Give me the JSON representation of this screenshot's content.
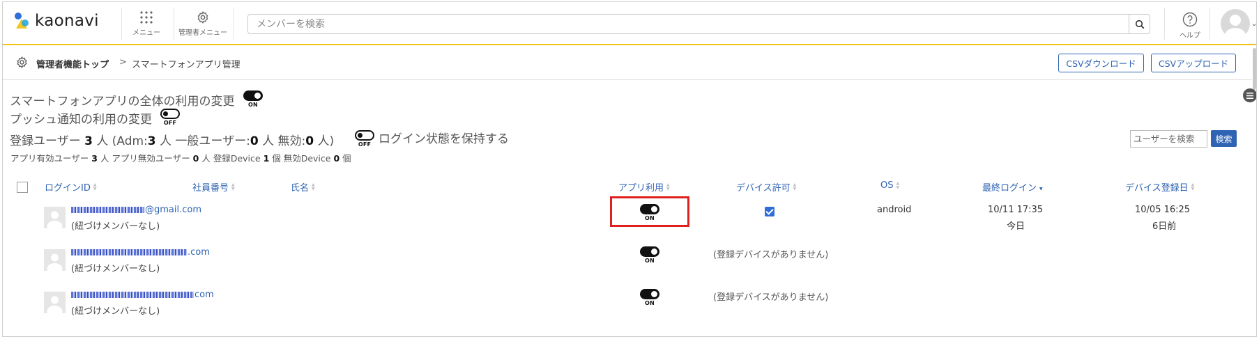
{
  "header": {
    "logo_text": "kaonavi",
    "menu_label": "メニュー",
    "admin_menu_label": "管理者メニュー",
    "search_placeholder": "メンバーを検索",
    "help_label": "ヘルプ"
  },
  "breadcrumb": {
    "root": "管理者機能トップ",
    "separator": ">",
    "current": "スマートフォンアプリ管理"
  },
  "actions": {
    "csv_download": "CSVダウンロード",
    "csv_upload": "CSVアップロード"
  },
  "settings": {
    "app_usage_label": "スマートフォンアプリの全体の利用の変更",
    "app_usage_state": "ON",
    "push_label": "プッシュ通知の利用の変更",
    "push_state": "OFF",
    "keep_login_state": "OFF",
    "keep_login_label": "ログイン状態を保持する"
  },
  "stats": {
    "reg_prefix": "登録ユーザー",
    "reg_count": "3",
    "reg_mid1": "人 (Adm:",
    "adm_count": "3",
    "reg_mid2": "人 一般ユーザー:",
    "general_count": "0",
    "reg_mid3": "人 無効:",
    "invalid_count": "0",
    "reg_suffix": "人)",
    "app_valid_label": "アプリ有効ユーザー",
    "app_valid_count": "3",
    "app_invalid_label": "人 アプリ無効ユーザー",
    "app_invalid_count": "0",
    "device_label": "人 登録Device",
    "device_count": "1",
    "invalid_device_label": "個 無効Device",
    "invalid_device_count": "0",
    "unit": "個"
  },
  "user_search": {
    "placeholder": "ユーザーを検索",
    "button": "検索"
  },
  "table": {
    "columns": [
      "ログインID",
      "社員番号",
      "氏名",
      "アプリ利用",
      "デバイス許可",
      "OS",
      "最終ログイン",
      "デバイス登録日"
    ],
    "rows": [
      {
        "email_suffix": "@gmail.com",
        "member": "(紐づけメンバーなし)",
        "app_state": "ON",
        "os": "android",
        "last_login": "10/11 17:35",
        "last_login_rel": "今日",
        "reg_date": "10/05 16:25",
        "reg_date_rel": "6日前"
      },
      {
        "email_suffix": ".com",
        "member": "(紐づけメンバーなし)",
        "app_state": "ON",
        "no_device": "(登録デバイスがありません)"
      },
      {
        "email_suffix": "com",
        "member": "(紐づけメンバーなし)",
        "app_state": "ON",
        "no_device": "(登録デバイスがありません)"
      }
    ]
  },
  "colors": {
    "accent_yellow": "#f2c418",
    "link_blue": "#2f63b4",
    "highlight_red": "#e01e1e"
  }
}
